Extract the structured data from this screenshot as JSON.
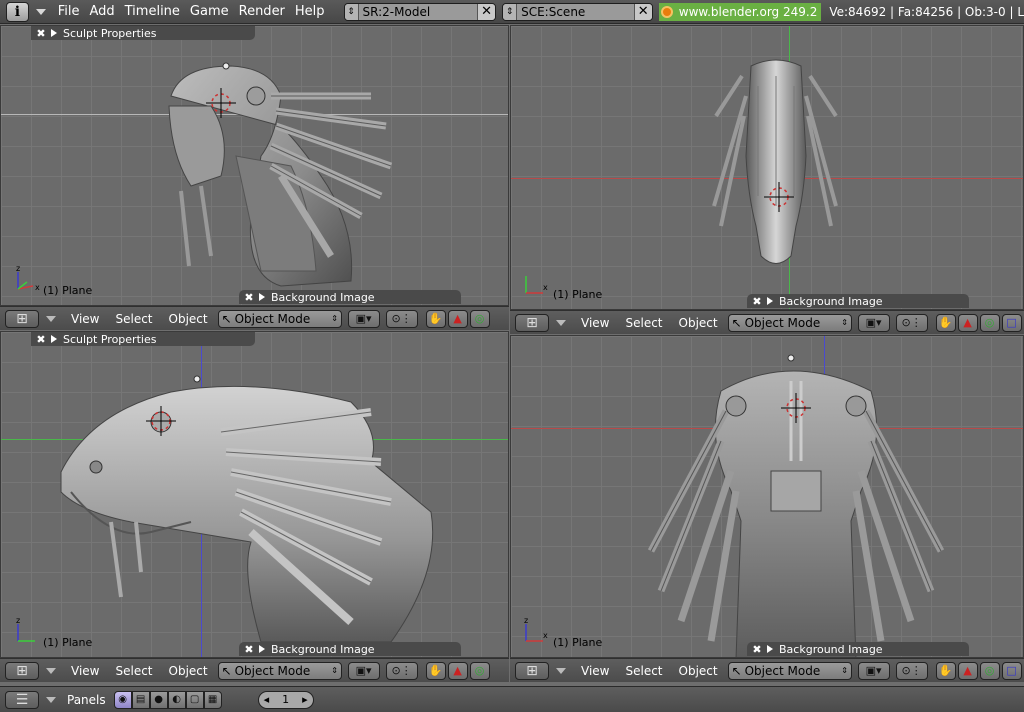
{
  "topbar": {
    "info_icon": "i",
    "menus": [
      "File",
      "Add",
      "Timeline",
      "Game",
      "Render",
      "Help"
    ],
    "screen_field": "SR:2-Model",
    "scene_field": "SCE:Scene",
    "url": "www.blender.org 249.2",
    "stats": "Ve:84692 | Fa:84256 | Ob:3-0 | L"
  },
  "viewports": [
    {
      "sculpt_panel": "Sculpt Properties",
      "object_label": "(1) Plane",
      "bg_panel": "Background Image",
      "header": {
        "view": "View",
        "select": "Select",
        "object": "Object",
        "mode": "Object Mode"
      }
    },
    {
      "object_label": "(1) Plane",
      "bg_panel": "Background Image",
      "header": {
        "view": "View",
        "select": "Select",
        "object": "Object",
        "mode": "Object Mode"
      }
    },
    {
      "sculpt_panel": "Sculpt Properties",
      "object_label": "(1) Plane",
      "bg_panel": "Background Image",
      "header": {
        "view": "View",
        "select": "Select",
        "object": "Object",
        "mode": "Object Mode"
      }
    },
    {
      "object_label": "(1) Plane",
      "bg_panel": "Background Image",
      "header": {
        "view": "View",
        "select": "Select",
        "object": "Object",
        "mode": "Object Mode"
      }
    }
  ],
  "gizmo": {
    "z": "z",
    "x": "x"
  },
  "bottombar": {
    "panels_label": "Panels",
    "page_value": "1"
  },
  "colors": {
    "axis_red": "#b84a4a",
    "axis_green": "#4ab84a",
    "axis_blue": "#4a4ad0",
    "url_bg": "#6ab043",
    "grid_bg": "#6b6b6b"
  }
}
